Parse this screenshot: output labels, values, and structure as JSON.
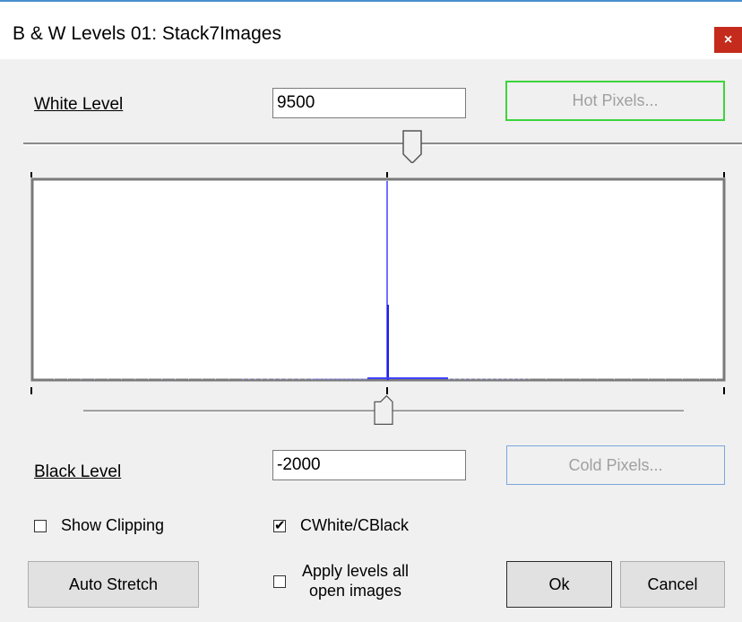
{
  "window": {
    "title": "B & W Levels 01: Stack7Images",
    "close_symbol": "×"
  },
  "white_level": {
    "label": "White Level",
    "value": "9500",
    "slider_fraction": 0.55
  },
  "hot_pixels_button": "Hot Pixels...",
  "black_level": {
    "label": "Black Level",
    "value": "-2000",
    "slider_fraction": 0.52
  },
  "cold_pixels_button": "Cold Pixels...",
  "histogram": {
    "color": "#4040ff"
  },
  "show_clipping": {
    "label": "Show Clipping",
    "checked": false
  },
  "cwhite_cblack": {
    "label": "CWhite/CBlack",
    "checked": true,
    "mark": "✔"
  },
  "auto_stretch_button": "Auto  Stretch",
  "apply_levels": {
    "label_line1": "Apply levels all",
    "label_line2": "open images",
    "checked": false
  },
  "ok_button": "Ok",
  "cancel_button": "Cancel"
}
